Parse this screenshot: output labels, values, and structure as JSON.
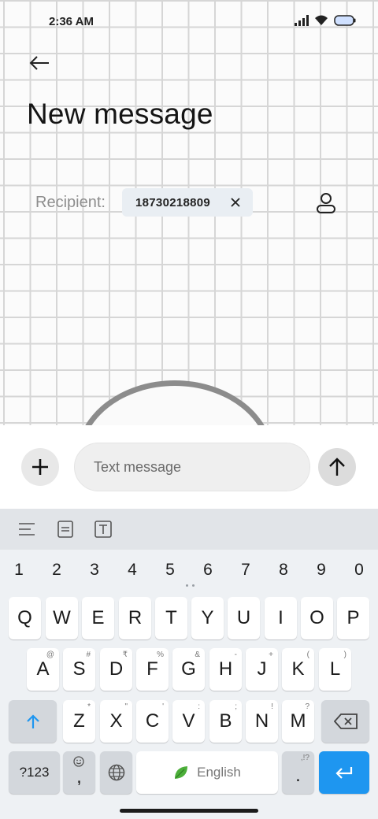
{
  "status_bar": {
    "time": "2:36 AM"
  },
  "header": {
    "title": "New message"
  },
  "recipient": {
    "label": "Recipient:",
    "chip_value": "18730218809"
  },
  "compose": {
    "placeholder": "Text message"
  },
  "keyboard": {
    "numbers": [
      "1",
      "2",
      "3",
      "4",
      "5",
      "6",
      "7",
      "8",
      "9",
      "0"
    ],
    "row1": [
      {
        "key": "Q"
      },
      {
        "key": "W"
      },
      {
        "key": "E"
      },
      {
        "key": "R"
      },
      {
        "key": "T"
      },
      {
        "key": "Y"
      },
      {
        "key": "U"
      },
      {
        "key": "I"
      },
      {
        "key": "O"
      },
      {
        "key": "P"
      }
    ],
    "row2": [
      {
        "key": "A",
        "sub": "@"
      },
      {
        "key": "S",
        "sub": "#"
      },
      {
        "key": "D",
        "sub": "₹"
      },
      {
        "key": "F",
        "sub": "%"
      },
      {
        "key": "G",
        "sub": "&"
      },
      {
        "key": "H",
        "sub": "-"
      },
      {
        "key": "J",
        "sub": "+"
      },
      {
        "key": "K",
        "sub": "("
      },
      {
        "key": "L",
        "sub": ")"
      }
    ],
    "row3": [
      {
        "key": "Z",
        "sub": "*"
      },
      {
        "key": "X",
        "sub": "\""
      },
      {
        "key": "C",
        "sub": "'"
      },
      {
        "key": "V",
        "sub": ":"
      },
      {
        "key": "B",
        "sub": ";"
      },
      {
        "key": "N",
        "sub": "!"
      },
      {
        "key": "M",
        "sub": "?"
      }
    ],
    "symbols_label": "?123",
    "comma_label": ",",
    "space_label": "English",
    "period_label": ".",
    "period_sub": ",!?",
    "accent_color": "#1e96f0"
  }
}
